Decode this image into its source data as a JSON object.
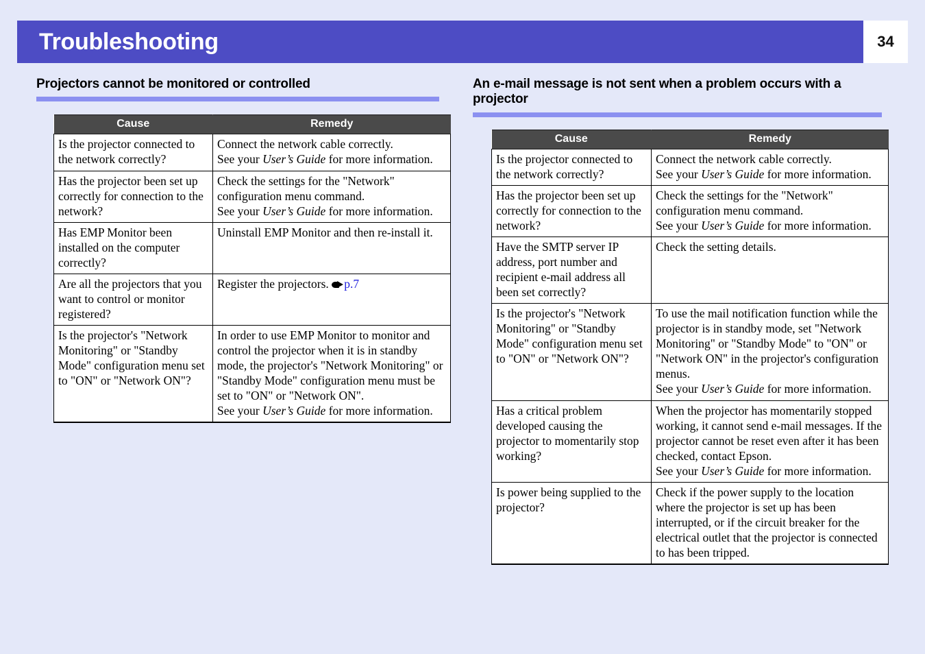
{
  "header": {
    "title": "Troubleshooting",
    "page_number": "34",
    "band_color": "#4d4cc4",
    "background_color": "#e4e8f9"
  },
  "sections": [
    {
      "heading": "Projectors cannot be monitored or controlled",
      "rule_color": "#8b90f0",
      "table": {
        "columns": [
          "Cause",
          "Remedy"
        ],
        "rows": [
          {
            "cause": "Is the projector connected to the network correctly?",
            "remedy_parts": [
              {
                "text": "Connect the network cable correctly."
              },
              {
                "text": "See your "
              },
              {
                "text": "User’s Guide",
                "style": "italic"
              },
              {
                "text": " for more information."
              }
            ]
          },
          {
            "cause": "Has the projector been set up correctly for connection to the network?",
            "remedy_parts": [
              {
                "text": "Check the settings for the \"Network\" configuration menu command."
              },
              {
                "text": "See your "
              },
              {
                "text": "User’s Guide",
                "style": "italic"
              },
              {
                "text": " for more information."
              }
            ]
          },
          {
            "cause": "Has EMP Monitor been installed on the computer correctly?",
            "remedy_parts": [
              {
                "text": "Uninstall EMP Monitor and then re-install it."
              }
            ]
          },
          {
            "cause": "Are all the projectors that you want to control or monitor registered?",
            "remedy_parts": [
              {
                "text": "Register the projectors. "
              },
              {
                "text": "p.7",
                "style": "link",
                "icon": "pointing-hand-icon"
              }
            ]
          },
          {
            "cause": "Is the projector's \"Network Monitoring\" or \"Standby Mode\" configuration menu set to \"ON\" or \"Network ON\"?",
            "remedy_parts": [
              {
                "text": "In order to use EMP Monitor to monitor and control the projector when it is in standby mode, the projector's \"Network Monitoring\" or \"Standby Mode\" configuration menu must be set to \"ON\" or \"Network ON\"."
              },
              {
                "text": "See your "
              },
              {
                "text": "User’s Guide",
                "style": "italic"
              },
              {
                "text": " for more information."
              }
            ]
          }
        ]
      }
    },
    {
      "heading": "An e-mail message is not sent when a problem occurs with a projector",
      "rule_color": "#8b90f0",
      "table": {
        "columns": [
          "Cause",
          "Remedy"
        ],
        "rows": [
          {
            "cause": "Is the projector connected to the network correctly?",
            "remedy_parts": [
              {
                "text": "Connect the network cable correctly."
              },
              {
                "text": "See your "
              },
              {
                "text": "User’s Guide",
                "style": "italic"
              },
              {
                "text": " for more information."
              }
            ]
          },
          {
            "cause": "Has the projector been set up correctly for connection to the network?",
            "remedy_parts": [
              {
                "text": "Check the settings for the \"Network\" configuration menu command."
              },
              {
                "text": "See your "
              },
              {
                "text": "User’s Guide",
                "style": "italic"
              },
              {
                "text": " for more information."
              }
            ]
          },
          {
            "cause": "Have the SMTP server IP address, port number and recipient e-mail address all been set correctly?",
            "remedy_parts": [
              {
                "text": "Check the setting details."
              }
            ]
          },
          {
            "cause": "Is the projector's \"Network Monitoring\" or \"Standby Mode\" configuration menu set to \"ON\" or \"Network ON\"?",
            "remedy_parts": [
              {
                "text": "To use the mail notification function while the projector is in standby mode, set \"Network Monitoring\" or \"Standby Mode\" to \"ON\" or \"Network ON\" in the projector's configuration menus."
              },
              {
                "text": "See your "
              },
              {
                "text": "User’s Guide",
                "style": "italic"
              },
              {
                "text": " for more information."
              }
            ]
          },
          {
            "cause": "Has a critical problem developed causing the projector to momentarily stop working?",
            "remedy_parts": [
              {
                "text": "When the projector has momentarily stopped working, it cannot send e-mail messages. If the projector cannot be reset even after it has been checked, contact Epson."
              },
              {
                "text": "See your "
              },
              {
                "text": "User’s Guide",
                "style": "italic"
              },
              {
                "text": " for more information."
              }
            ]
          },
          {
            "cause": "Is power being supplied to the projector?",
            "remedy_parts": [
              {
                "text": "Check if the power supply to the location where the projector is set up has been interrupted, or if the circuit breaker for the electrical outlet that the projector is connected to has been tripped."
              }
            ]
          }
        ]
      }
    }
  ]
}
